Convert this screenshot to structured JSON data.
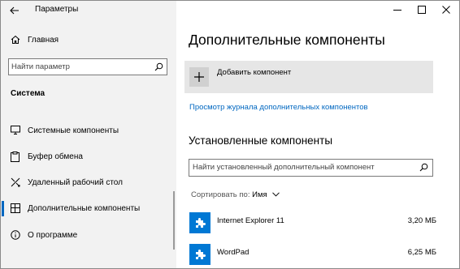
{
  "window": {
    "title": "Параметры"
  },
  "sidebar": {
    "home_label": "Главная",
    "search_placeholder": "Найти параметр",
    "section_title": "Система",
    "items": [
      {
        "label": "Системные компоненты",
        "icon": "monitor-icon"
      },
      {
        "label": "Буфер обмена",
        "icon": "clipboard-icon"
      },
      {
        "label": "Удаленный рабочий стол",
        "icon": "remote-desktop-icon"
      },
      {
        "label": "Дополнительные компоненты",
        "icon": "grid-icon",
        "active": true
      },
      {
        "label": "О программе",
        "icon": "info-icon"
      }
    ]
  },
  "main": {
    "title": "Дополнительные компоненты",
    "add_button_label": "Добавить компонент",
    "history_link": "Просмотр журнала дополнительных компонентов",
    "installed_title": "Установленные компоненты",
    "search_placeholder": "Найти установленный дополнительный компонент",
    "sort_label": "Сортировать по:",
    "sort_value": "Имя",
    "components": [
      {
        "name": "Internet Explorer 11",
        "size": "3,20 МБ"
      },
      {
        "name": "WordPad",
        "size": "6,25 МБ"
      }
    ]
  },
  "colors": {
    "accent": "#0067c0",
    "component_icon_bg": "#0078d4",
    "sidebar_bg": "#f2f2f2"
  }
}
